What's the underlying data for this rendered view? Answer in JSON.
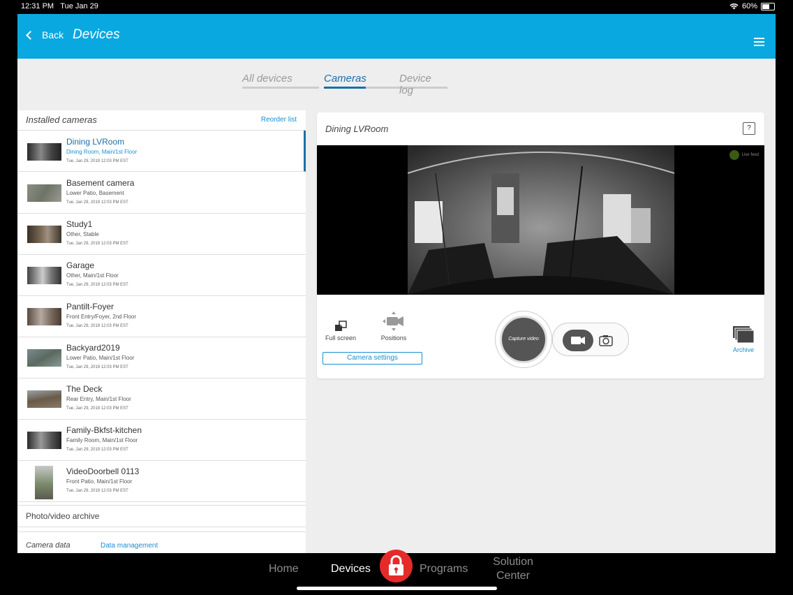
{
  "status_bar": {
    "time": "12:31 PM",
    "date": "Tue Jan 29",
    "battery": "60%",
    "battery_fraction": 0.6
  },
  "header": {
    "back_label": "Back",
    "title": "Devices"
  },
  "tabs": [
    {
      "label": "All devices",
      "active": false
    },
    {
      "label": "Cameras",
      "active": true
    },
    {
      "label": "Device log",
      "active": false
    }
  ],
  "installed": {
    "title": "Installed cameras",
    "reorder_label": "Reorder list",
    "cameras": [
      {
        "name": "Dining LVRoom",
        "location": "Dining Room, Main/1st Floor",
        "time": "Tue, Jan 29, 2019 12:03 PM EST",
        "selected": true
      },
      {
        "name": "Basement camera",
        "location": "Lower Patio, Basement",
        "time": "Tue, Jan 29, 2019 12:03 PM EST"
      },
      {
        "name": "Study1",
        "location": "Other, Stable",
        "time": "Tue, Jan 29, 2019 12:03 PM EST"
      },
      {
        "name": "Garage",
        "location": "Other, Main/1st Floor",
        "time": "Tue, Jan 29, 2019 12:03 PM EST"
      },
      {
        "name": "Pantilt-Foyer",
        "location": "Front Entry/Foyer, 2nd Floor",
        "time": "Tue, Jan 29, 2019 12:03 PM EST"
      },
      {
        "name": "Backyard2019",
        "location": "Lower Patio, Main/1st Floor",
        "time": "Tue, Jan 29, 2019 12:03 PM EST"
      },
      {
        "name": "The Deck",
        "location": "Rear Entry, Main/1st Floor",
        "time": "Tue, Jan 29, 2019 12:03 PM EST"
      },
      {
        "name": "Family-Bkfst-kitchen",
        "location": "Family Room, Main/1st Floor",
        "time": "Tue, Jan 29, 2019 12:03 PM EST"
      },
      {
        "name": "VideoDoorbell 0113",
        "location": "Front Patio, Main/1st Floor",
        "time": "Tue, Jan 29, 2019 12:03 PM EST"
      }
    ],
    "archive_label": "Photo/video archive",
    "camera_data_label": "Camera data",
    "data_management_label": "Data management"
  },
  "viewer": {
    "title": "Dining LVRoom",
    "help_label": "?",
    "live_feed_label": "Live feed",
    "fullscreen_label": "Full screen",
    "positions_label": "Positions",
    "camera_settings_label": "Camera settings",
    "capture_label": "Capture video",
    "archive_label": "Archive"
  },
  "bottom_nav": {
    "home": "Home",
    "devices": "Devices",
    "programs": "Programs",
    "solution_line1": "Solution",
    "solution_line2": "Center"
  },
  "colors": {
    "accent": "#0aa8e0",
    "selected": "#1a6fa8",
    "link": "#1a8fd0",
    "lock": "#e52a2a"
  }
}
